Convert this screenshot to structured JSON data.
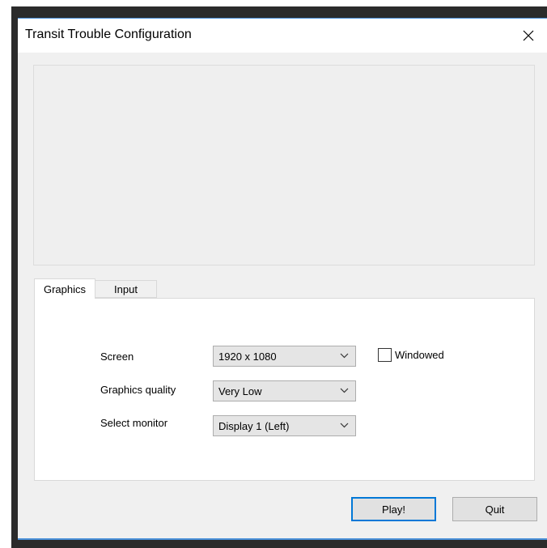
{
  "window": {
    "title": "Transit Trouble Configuration"
  },
  "tabs": [
    {
      "label": "Graphics",
      "active": true
    },
    {
      "label": "Input",
      "active": false
    }
  ],
  "graphics": {
    "screen": {
      "label": "Screen",
      "value": "1920 x 1080"
    },
    "quality": {
      "label": "Graphics quality",
      "value": "Very Low"
    },
    "monitor": {
      "label": "Select monitor",
      "value": "Display 1 (Left)"
    },
    "windowed": {
      "label": "Windowed",
      "checked": false
    }
  },
  "buttons": {
    "play": "Play!",
    "quit": "Quit"
  },
  "icons": {
    "close": "close-icon",
    "chevron": "chevron-down-icon"
  },
  "colors": {
    "accent": "#0078d7",
    "window_bg": "#f0f0f0"
  }
}
